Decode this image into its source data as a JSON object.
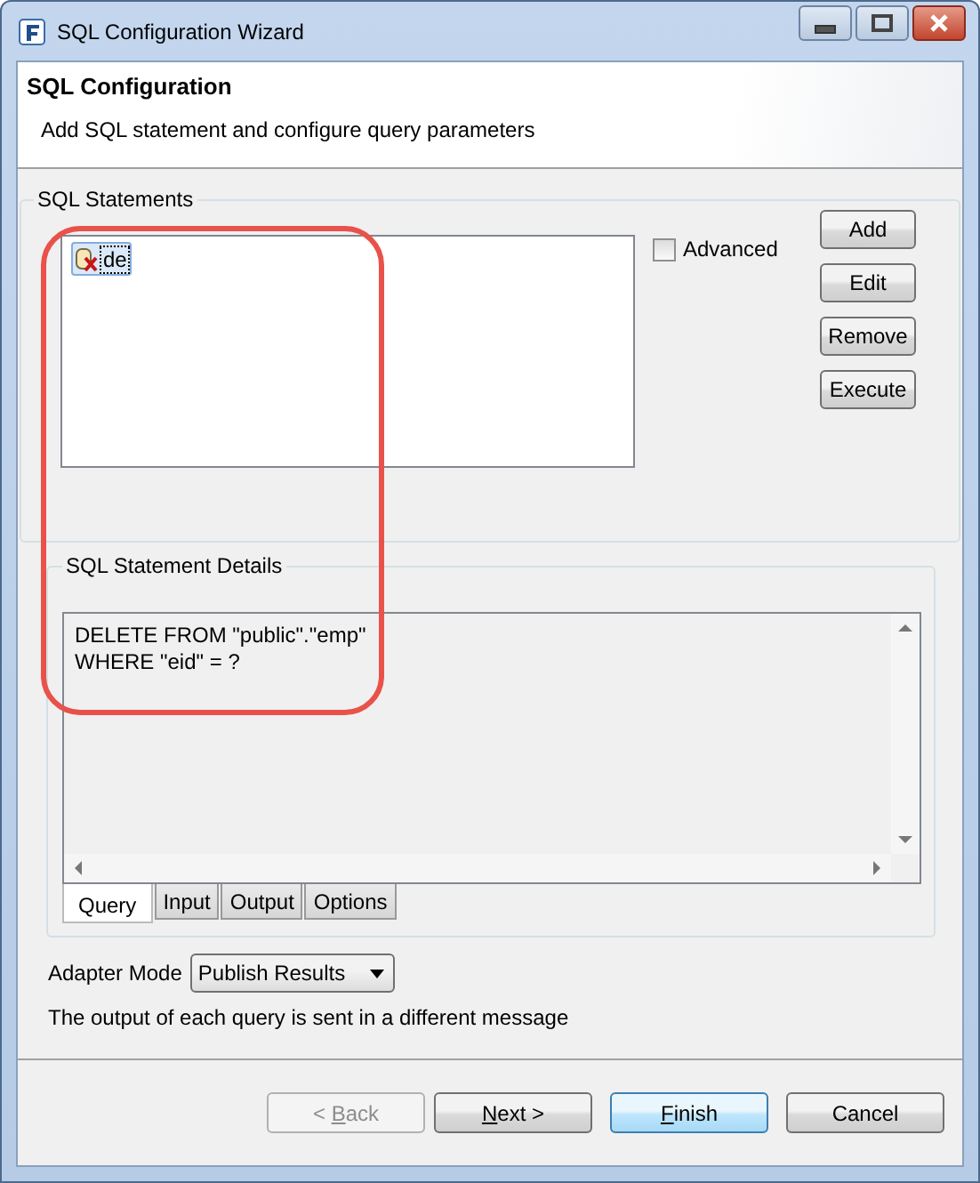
{
  "window": {
    "title": "SQL Configuration Wizard"
  },
  "header": {
    "title": "SQL Configuration",
    "subtitle": "Add SQL statement and configure query parameters"
  },
  "statements": {
    "legend": "SQL Statements",
    "items": [
      {
        "label": "de",
        "selected": true
      }
    ],
    "advanced": {
      "label": "Advanced",
      "checked": false
    },
    "buttons": [
      "Add",
      "Edit",
      "Remove",
      "Execute"
    ]
  },
  "details": {
    "legend": "SQL Statement Details",
    "sql": "DELETE FROM \"public\".\"emp\"\nWHERE \"eid\" = ?",
    "tabs": [
      {
        "label": "Query",
        "selected": true
      },
      {
        "label": "Input",
        "selected": false
      },
      {
        "label": "Output",
        "selected": false
      },
      {
        "label": "Options",
        "selected": false
      }
    ]
  },
  "adapter_mode": {
    "label": "Adapter Mode",
    "value": "Publish Results"
  },
  "note": "The output of each query is sent in a different message",
  "buttons": [
    {
      "label_before": "< ",
      "access_key": "B",
      "label_after": "ack",
      "disabled": true,
      "default": false
    },
    {
      "access_key": "N",
      "label_after": "ext >",
      "disabled": false,
      "default": false
    },
    {
      "access_key": "F",
      "label_after": "inish",
      "disabled": false,
      "default": true
    },
    {
      "label": "Cancel",
      "disabled": false,
      "default": false
    }
  ]
}
